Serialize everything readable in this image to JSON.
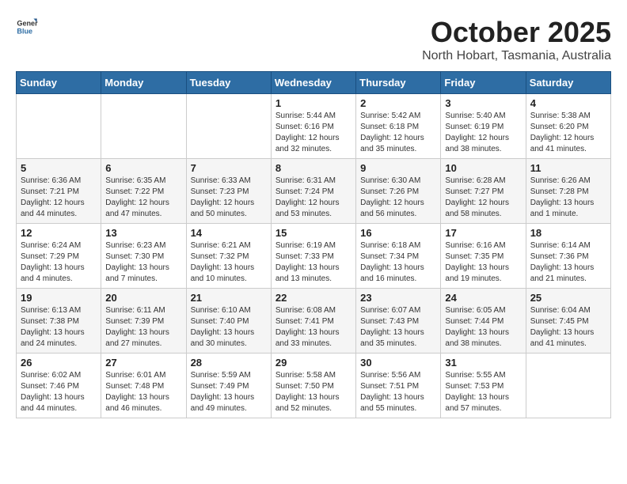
{
  "header": {
    "logo_general": "General",
    "logo_blue": "Blue",
    "month": "October 2025",
    "location": "North Hobart, Tasmania, Australia"
  },
  "days_of_week": [
    "Sunday",
    "Monday",
    "Tuesday",
    "Wednesday",
    "Thursday",
    "Friday",
    "Saturday"
  ],
  "weeks": [
    [
      {
        "day": "",
        "content": ""
      },
      {
        "day": "",
        "content": ""
      },
      {
        "day": "",
        "content": ""
      },
      {
        "day": "1",
        "content": "Sunrise: 5:44 AM\nSunset: 6:16 PM\nDaylight: 12 hours\nand 32 minutes."
      },
      {
        "day": "2",
        "content": "Sunrise: 5:42 AM\nSunset: 6:18 PM\nDaylight: 12 hours\nand 35 minutes."
      },
      {
        "day": "3",
        "content": "Sunrise: 5:40 AM\nSunset: 6:19 PM\nDaylight: 12 hours\nand 38 minutes."
      },
      {
        "day": "4",
        "content": "Sunrise: 5:38 AM\nSunset: 6:20 PM\nDaylight: 12 hours\nand 41 minutes."
      }
    ],
    [
      {
        "day": "5",
        "content": "Sunrise: 6:36 AM\nSunset: 7:21 PM\nDaylight: 12 hours\nand 44 minutes."
      },
      {
        "day": "6",
        "content": "Sunrise: 6:35 AM\nSunset: 7:22 PM\nDaylight: 12 hours\nand 47 minutes."
      },
      {
        "day": "7",
        "content": "Sunrise: 6:33 AM\nSunset: 7:23 PM\nDaylight: 12 hours\nand 50 minutes."
      },
      {
        "day": "8",
        "content": "Sunrise: 6:31 AM\nSunset: 7:24 PM\nDaylight: 12 hours\nand 53 minutes."
      },
      {
        "day": "9",
        "content": "Sunrise: 6:30 AM\nSunset: 7:26 PM\nDaylight: 12 hours\nand 56 minutes."
      },
      {
        "day": "10",
        "content": "Sunrise: 6:28 AM\nSunset: 7:27 PM\nDaylight: 12 hours\nand 58 minutes."
      },
      {
        "day": "11",
        "content": "Sunrise: 6:26 AM\nSunset: 7:28 PM\nDaylight: 13 hours\nand 1 minute."
      }
    ],
    [
      {
        "day": "12",
        "content": "Sunrise: 6:24 AM\nSunset: 7:29 PM\nDaylight: 13 hours\nand 4 minutes."
      },
      {
        "day": "13",
        "content": "Sunrise: 6:23 AM\nSunset: 7:30 PM\nDaylight: 13 hours\nand 7 minutes."
      },
      {
        "day": "14",
        "content": "Sunrise: 6:21 AM\nSunset: 7:32 PM\nDaylight: 13 hours\nand 10 minutes."
      },
      {
        "day": "15",
        "content": "Sunrise: 6:19 AM\nSunset: 7:33 PM\nDaylight: 13 hours\nand 13 minutes."
      },
      {
        "day": "16",
        "content": "Sunrise: 6:18 AM\nSunset: 7:34 PM\nDaylight: 13 hours\nand 16 minutes."
      },
      {
        "day": "17",
        "content": "Sunrise: 6:16 AM\nSunset: 7:35 PM\nDaylight: 13 hours\nand 19 minutes."
      },
      {
        "day": "18",
        "content": "Sunrise: 6:14 AM\nSunset: 7:36 PM\nDaylight: 13 hours\nand 21 minutes."
      }
    ],
    [
      {
        "day": "19",
        "content": "Sunrise: 6:13 AM\nSunset: 7:38 PM\nDaylight: 13 hours\nand 24 minutes."
      },
      {
        "day": "20",
        "content": "Sunrise: 6:11 AM\nSunset: 7:39 PM\nDaylight: 13 hours\nand 27 minutes."
      },
      {
        "day": "21",
        "content": "Sunrise: 6:10 AM\nSunset: 7:40 PM\nDaylight: 13 hours\nand 30 minutes."
      },
      {
        "day": "22",
        "content": "Sunrise: 6:08 AM\nSunset: 7:41 PM\nDaylight: 13 hours\nand 33 minutes."
      },
      {
        "day": "23",
        "content": "Sunrise: 6:07 AM\nSunset: 7:43 PM\nDaylight: 13 hours\nand 35 minutes."
      },
      {
        "day": "24",
        "content": "Sunrise: 6:05 AM\nSunset: 7:44 PM\nDaylight: 13 hours\nand 38 minutes."
      },
      {
        "day": "25",
        "content": "Sunrise: 6:04 AM\nSunset: 7:45 PM\nDaylight: 13 hours\nand 41 minutes."
      }
    ],
    [
      {
        "day": "26",
        "content": "Sunrise: 6:02 AM\nSunset: 7:46 PM\nDaylight: 13 hours\nand 44 minutes."
      },
      {
        "day": "27",
        "content": "Sunrise: 6:01 AM\nSunset: 7:48 PM\nDaylight: 13 hours\nand 46 minutes."
      },
      {
        "day": "28",
        "content": "Sunrise: 5:59 AM\nSunset: 7:49 PM\nDaylight: 13 hours\nand 49 minutes."
      },
      {
        "day": "29",
        "content": "Sunrise: 5:58 AM\nSunset: 7:50 PM\nDaylight: 13 hours\nand 52 minutes."
      },
      {
        "day": "30",
        "content": "Sunrise: 5:56 AM\nSunset: 7:51 PM\nDaylight: 13 hours\nand 55 minutes."
      },
      {
        "day": "31",
        "content": "Sunrise: 5:55 AM\nSunset: 7:53 PM\nDaylight: 13 hours\nand 57 minutes."
      },
      {
        "day": "",
        "content": ""
      }
    ]
  ]
}
